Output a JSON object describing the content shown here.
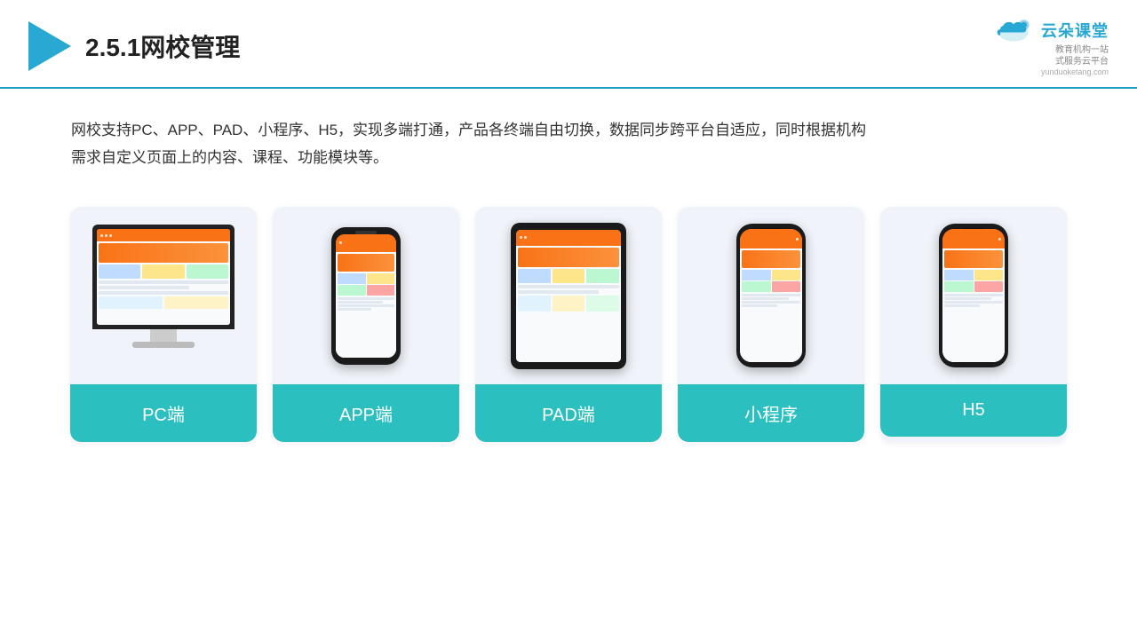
{
  "header": {
    "title": "2.5.1网校管理",
    "brand_name": "云朵课堂",
    "brand_url": "yunduoketang.com",
    "brand_tagline_line1": "教育机构一站",
    "brand_tagline_line2": "式服务云平台"
  },
  "description": {
    "text": "网校支持PC、APP、PAD、小程序、H5，实现多端打通，产品各终端自由切换，数据同步跨平台自适应，同时根据机构需求自定义页面上的内容、课程、功能模块等。"
  },
  "cards": [
    {
      "id": "pc",
      "label": "PC端",
      "type": "pc"
    },
    {
      "id": "app",
      "label": "APP端",
      "type": "phone"
    },
    {
      "id": "pad",
      "label": "PAD端",
      "type": "tablet"
    },
    {
      "id": "miniapp",
      "label": "小程序",
      "type": "phone_notch"
    },
    {
      "id": "h5",
      "label": "H5",
      "type": "phone_notch"
    }
  ],
  "colors": {
    "accent": "#2bbfbf",
    "header_line": "#1a9fc3",
    "title": "#222222",
    "text": "#333333",
    "card_bg": "#f0f4fa"
  }
}
